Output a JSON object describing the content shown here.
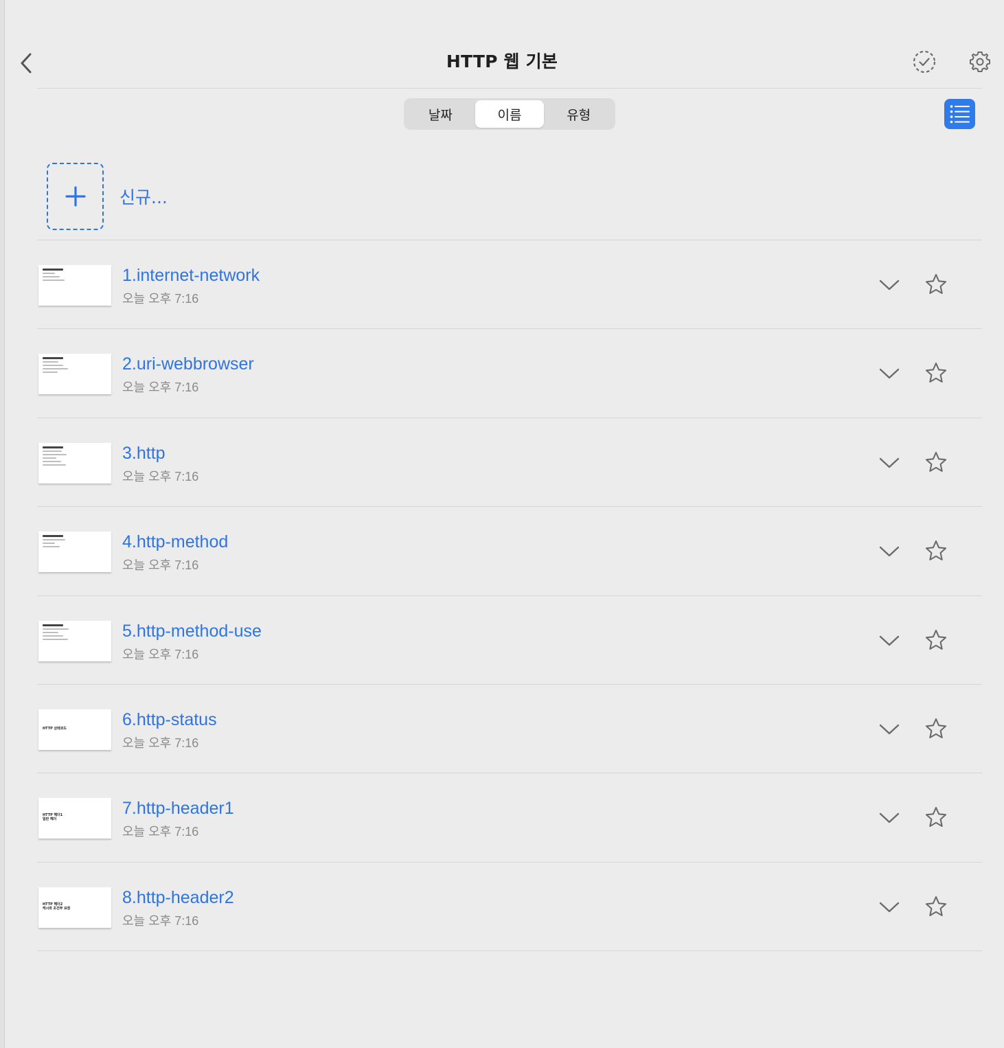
{
  "header": {
    "title": "HTTP 웹 기본"
  },
  "sort": {
    "options": [
      "날짜",
      "이름",
      "유형"
    ],
    "selected": "이름"
  },
  "new_item": {
    "label": "신규..."
  },
  "accent_color": "#2f74e0",
  "files": [
    {
      "name": "1.internet-network",
      "date": "오늘 오후 7:16",
      "thumb_caption": ""
    },
    {
      "name": "2.uri-webbrowser",
      "date": "오늘 오후 7:16",
      "thumb_caption": ""
    },
    {
      "name": "3.http",
      "date": "오늘 오후 7:16",
      "thumb_caption": ""
    },
    {
      "name": "4.http-method",
      "date": "오늘 오후 7:16",
      "thumb_caption": ""
    },
    {
      "name": "5.http-method-use",
      "date": "오늘 오후 7:16",
      "thumb_caption": ""
    },
    {
      "name": "6.http-status",
      "date": "오늘 오후 7:16",
      "thumb_caption": "HTTP 상태코드"
    },
    {
      "name": "7.http-header1",
      "date": "오늘 오후 7:16",
      "thumb_caption": "HTTP 헤더1\n일반 헤더"
    },
    {
      "name": "8.http-header2",
      "date": "오늘 오후 7:16",
      "thumb_caption": "HTTP 헤더2\n캐시와 조건부 요청"
    }
  ],
  "icons": {
    "back": "chevron-left-icon",
    "select": "dashed-check-circle-icon",
    "settings": "gear-icon",
    "view_mode": "list-icon",
    "add": "plus-icon",
    "expand": "chevron-down-icon",
    "favorite": "star-icon"
  }
}
